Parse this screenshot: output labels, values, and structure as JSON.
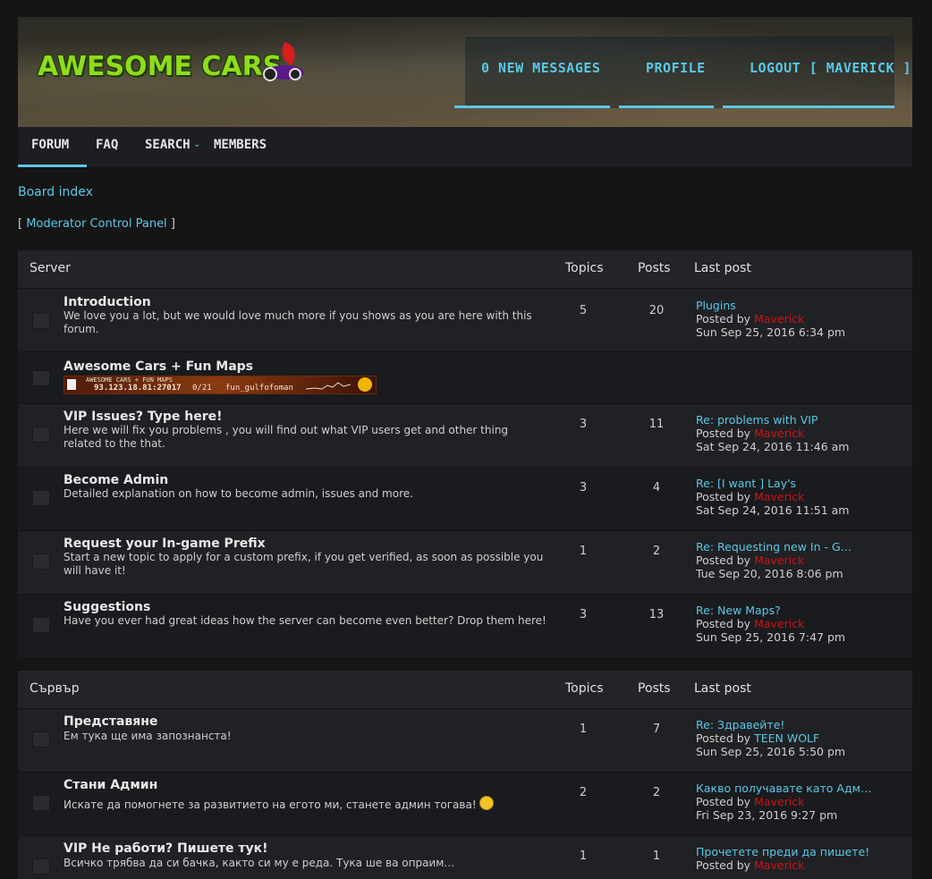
{
  "header": {
    "logo_text": "AWESOME CARS",
    "nav": [
      {
        "label": "0  NEW MESSAGES"
      },
      {
        "label": "PROFILE"
      },
      {
        "label": "LOGOUT [ MAVERICK ]"
      }
    ]
  },
  "navbar": {
    "items": [
      {
        "label": "FORUM",
        "active": true
      },
      {
        "label": "FAQ"
      },
      {
        "label": "SEARCH"
      },
      {
        "label": "MEMBERS"
      }
    ]
  },
  "breadcrumb": "Board index",
  "mcp": {
    "open": "[",
    "label": "Moderator Control Panel",
    "close": "]"
  },
  "forums": [
    {
      "category": "Server",
      "col_topics": "Topics",
      "col_posts": "Posts",
      "col_last": "Last post",
      "rows": [
        {
          "title": "Introduction",
          "desc": "We love you a lot, but we would love much more if you shows as you are here with this forum.",
          "topics": "5",
          "posts": "20",
          "last_title": "Plugins",
          "posted_by": "Posted by",
          "user": "Maverick",
          "date": "Sun Sep 25, 2016 6:34 pm"
        },
        {
          "title": "Awesome Cars + Fun Maps",
          "server_banner": {
            "name": "AWESOME CARS + FUN MAPS",
            "ip": "93.123.18.81:27017",
            "players": "0/21",
            "map": "fun_gulfofoman"
          }
        },
        {
          "title": "VIP Issues? Type here!",
          "desc": "Here we will fix you problems , you will find out what VIP users get and other thing related to the that.",
          "topics": "3",
          "posts": "11",
          "last_title": "Re: problems with VIP",
          "posted_by": "Posted by",
          "user": "Maverick",
          "date": "Sat Sep 24, 2016 11:46 am"
        },
        {
          "title": "Become Admin",
          "desc": "Detailed explanation on how to become admin, issues and more.",
          "topics": "3",
          "posts": "4",
          "last_title": "Re: [I want ] Lay's",
          "posted_by": "Posted by",
          "user": "Maverick",
          "date": "Sat Sep 24, 2016 11:51 am"
        },
        {
          "title": "Request your In-game Prefix",
          "desc": "Start a new topic to apply for a custom prefix, if you get verified, as soon as possible you will have it!",
          "topics": "1",
          "posts": "2",
          "last_title": "Re: Requesting new In - G…",
          "posted_by": "Posted by",
          "user": "Maverick",
          "date": "Tue Sep 20, 2016 8:06 pm"
        },
        {
          "title": "Suggestions",
          "desc": "Have you ever had great ideas how the server can become even better? Drop them here!",
          "topics": "3",
          "posts": "13",
          "last_title": "Re: New Maps?",
          "posted_by": "Posted by",
          "user": "Maverick",
          "date": "Sun Sep 25, 2016 7:47 pm"
        }
      ]
    },
    {
      "category": "Сървър",
      "col_topics": "Topics",
      "col_posts": "Posts",
      "col_last": "Last post",
      "rows": [
        {
          "title": "Представяне",
          "desc": "Ем тука ще има запознанста!",
          "topics": "1",
          "posts": "7",
          "last_title": "Re: Здравейте!",
          "posted_by": "Posted by",
          "user": "TEEN WOLF",
          "date": "Sun Sep 25, 2016 5:50 pm"
        },
        {
          "title": "Стани Админ",
          "desc": "Искате да помогнете за развитието на егото ми, станете админ тогава!",
          "topics": "2",
          "posts": "2",
          "last_title": "Какво получавате като Адм…",
          "posted_by": "Posted by",
          "user": "Maverick",
          "date": "Fri Sep 23, 2016 9:27 pm"
        },
        {
          "title": "VIP Не работи? Пишете тук!",
          "desc": "Всичко трябва да си бачка, както си му е реда. Тука ше ва опраим…",
          "topics": "1",
          "posts": "1",
          "last_title": "Прочетете преди да пишете!",
          "posted_by": "Posted by",
          "user": "Maverick",
          "date": ""
        }
      ]
    }
  ]
}
